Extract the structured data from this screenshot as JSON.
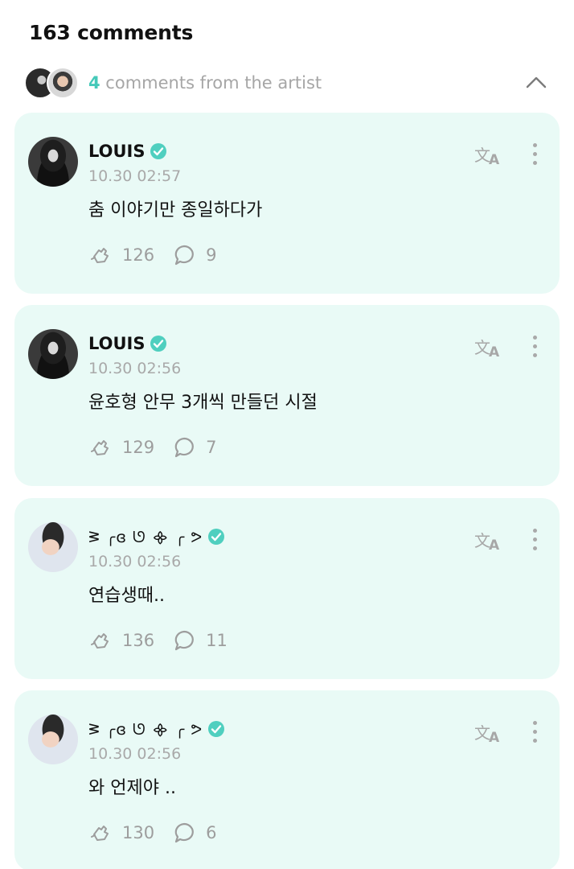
{
  "header": {
    "comment_count": "163 comments"
  },
  "artist_bar": {
    "count": "4",
    "label": " comments from the artist",
    "toggle_icon": "chevron-up-icon"
  },
  "colors": {
    "accent": "#45c9b9",
    "card_bg": "#e9faf6",
    "muted": "#a9a9a9"
  },
  "comments": [
    {
      "name": "LOUIS",
      "time": "10.30 02:57",
      "text": "춤 이야기만 종일하다가",
      "likes": "126",
      "replies": "9",
      "avatar": "dark"
    },
    {
      "name": "LOUIS",
      "time": "10.30 02:56",
      "text": "윤호형 안무 3개씩 만들던 시절",
      "likes": "129",
      "replies": "7",
      "avatar": "dark"
    },
    {
      "name": "ᕒ ╭ɞ ᘎ ᯽ ╭ ᕗ",
      "time": "10.30 02:56",
      "text": "연습생때..",
      "likes": "136",
      "replies": "11",
      "avatar": "light"
    },
    {
      "name": "ᕒ ╭ɞ ᘎ ᯽ ╭ ᕗ",
      "time": "10.30 02:56",
      "text": "와 언제야 ..",
      "likes": "130",
      "replies": "6",
      "avatar": "light"
    }
  ]
}
